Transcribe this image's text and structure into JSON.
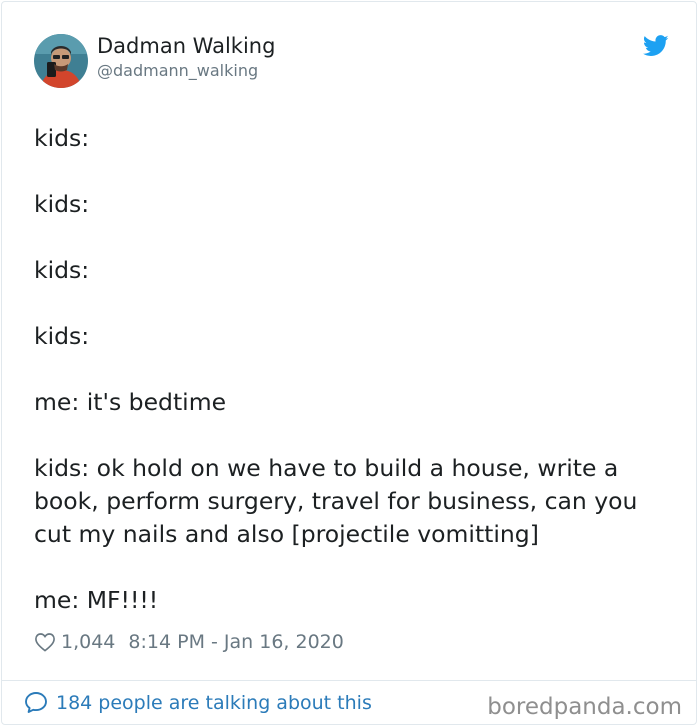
{
  "author": {
    "display_name": "Dadman Walking",
    "handle": "@dadmann_walking"
  },
  "tweet": {
    "lines": [
      "kids:",
      "kids:",
      "kids:",
      "kids:",
      "me: it's bedtime",
      "kids: ok hold on we have to build a house, write a book, perform surgery, travel for business, can you cut my nails and also [projectile vomitting]",
      "me: MF!!!!"
    ]
  },
  "meta": {
    "likes": "1,044",
    "timestamp": "8:14 PM - Jan 16, 2020"
  },
  "footer": {
    "conversation": "184 people are talking about this",
    "watermark": "boredpanda.com"
  },
  "icons": {
    "platform": "twitter-bird-icon",
    "like": "heart-icon",
    "reply": "speech-bubble-icon"
  },
  "colors": {
    "accent": "#1da1f2",
    "link": "#2b7bb9",
    "muted": "#697882"
  }
}
